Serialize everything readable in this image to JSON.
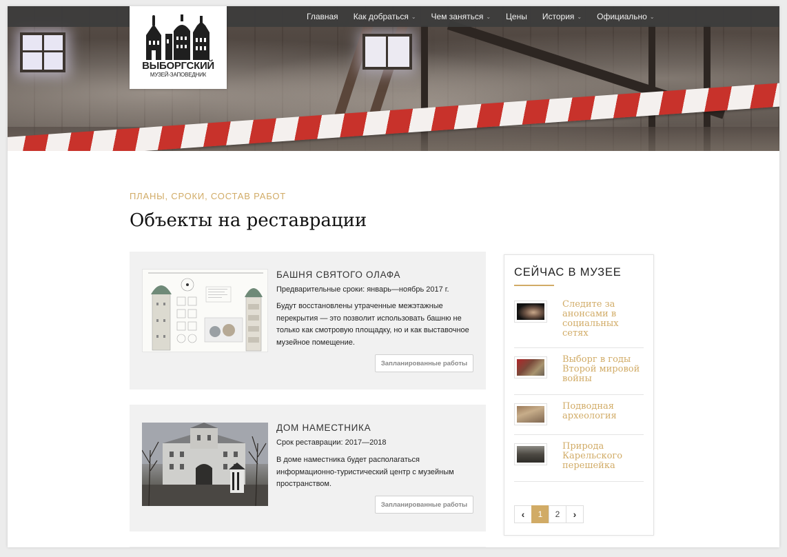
{
  "nav": {
    "items": [
      {
        "label": "Главная",
        "has_dropdown": false
      },
      {
        "label": "Как добраться",
        "has_dropdown": true
      },
      {
        "label": "Чем заняться",
        "has_dropdown": true
      },
      {
        "label": "Цены",
        "has_dropdown": false
      },
      {
        "label": "История",
        "has_dropdown": true
      },
      {
        "label": "Официально",
        "has_dropdown": true
      }
    ],
    "chevron": "⌄"
  },
  "logo": {
    "line1": "ВЫБОРГСКИЙ",
    "line2": "МУЗЕЙ-ЗАПОВЕДНИК"
  },
  "header": {
    "kicker": "ПЛАНЫ, СРОКИ, СОСТАВ РАБОТ",
    "title": "Объекты на реставрации"
  },
  "cards": [
    {
      "title": "БАШНЯ СВЯТОГО ОЛАФА",
      "dates": "Предварительные сроки: январь—ноябрь 2017 г.",
      "description": "Будут восстановлены утраченные межэтажные перекрытия — это позволит использовать башню не только как смотровую площадку, но и как выставочное музейное помещение.",
      "button": "Запланированные работы"
    },
    {
      "title": "ДОМ НАМЕСТНИКА",
      "dates": "Срок реставрации: 2017—2018",
      "description": "В доме наместника будет располагаться информационно-туристический центр с музейным пространством.",
      "button": "Запланированные работы"
    }
  ],
  "sidebar": {
    "title": "СЕЙЧАС В МУЗЕЕ",
    "items": [
      {
        "label": "Следите за анонсами в социальных сетях"
      },
      {
        "label": "Выборг в годы Второй мировой войны"
      },
      {
        "label": "Подводная археология"
      },
      {
        "label": "Природа Карельского перешейка"
      }
    ],
    "pager": {
      "prev": "‹",
      "pages": [
        "1",
        "2"
      ],
      "current": "1",
      "next": "›"
    }
  },
  "colors": {
    "accent": "#d1ab66",
    "navbar": "#3c3c3c",
    "card_bg": "#f1f1f1"
  }
}
